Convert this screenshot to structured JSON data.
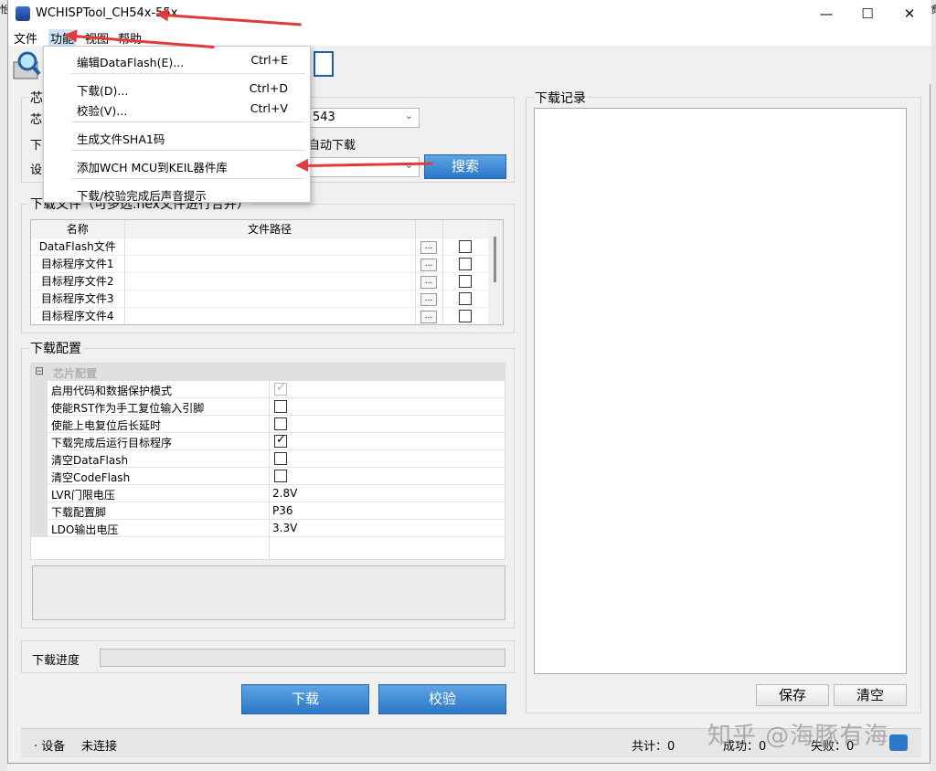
{
  "window": {
    "title": "WCHISPTool_CH54x-55x",
    "minimize": "—",
    "maximize": "☐",
    "close": "✕"
  },
  "menubar": {
    "file": "文件",
    "function": "功能",
    "view": "视图",
    "help": "帮助"
  },
  "left_clip": {
    "top": "怡",
    "chip_title": "芯",
    "chip_label": "芯",
    "download_label": "下",
    "device_label": "设"
  },
  "chip": {
    "model_value": "543",
    "auto_download": "自动下载",
    "search_button": "搜索"
  },
  "files": {
    "title": "下载文件（可多选.hex文件进行合并）",
    "columns": [
      "名称",
      "文件路径"
    ],
    "rows": [
      {
        "name": "DataFlash文件",
        "path": "",
        "browse": "...",
        "checked": false
      },
      {
        "name": "目标程序文件1",
        "path": "",
        "browse": "...",
        "checked": false
      },
      {
        "name": "目标程序文件2",
        "path": "",
        "browse": "...",
        "checked": false
      },
      {
        "name": "目标程序文件3",
        "path": "",
        "browse": "...",
        "checked": false
      },
      {
        "name": "目标程序文件4",
        "path": "",
        "browse": "...",
        "checked": false
      }
    ]
  },
  "config": {
    "title": "下载配置",
    "section": "芯片配置",
    "expander": "⊟",
    "rows": [
      {
        "label": "启用代码和数据保护模式",
        "type": "check",
        "checked": true,
        "disabled": true
      },
      {
        "label": "使能RST作为手工复位输入引脚",
        "type": "check",
        "checked": false,
        "disabled": false
      },
      {
        "label": "使能上电复位后长延时",
        "type": "check",
        "checked": false,
        "disabled": false
      },
      {
        "label": "下载完成后运行目标程序",
        "type": "check",
        "checked": true,
        "disabled": false
      },
      {
        "label": "清空DataFlash",
        "type": "check",
        "checked": false,
        "disabled": false
      },
      {
        "label": "清空CodeFlash",
        "type": "check",
        "checked": false,
        "disabled": false
      },
      {
        "label": "LVR门限电压",
        "type": "value",
        "value": "2.8V"
      },
      {
        "label": "下载配置脚",
        "type": "value",
        "value": "P36"
      },
      {
        "label": "LDO输出电压",
        "type": "value",
        "value": "3.3V"
      }
    ]
  },
  "progress": {
    "label": "下载进度",
    "value": 0
  },
  "actions": {
    "download": "下载",
    "verify": "校验"
  },
  "log": {
    "title": "下载记录",
    "save": "保存",
    "clear": "清空"
  },
  "status": {
    "device_prefix": "· 设备",
    "device_state": "未连接",
    "total": "共计：0",
    "success": "成功：0",
    "fail": "失败：0",
    "right_clip": "愤"
  },
  "watermark": "知乎 @海豚有海",
  "dropdown_menu": {
    "items": [
      {
        "label": "编辑DataFlash(E)...",
        "shortcut": "Ctrl+E"
      },
      {
        "label": "下载(D)...",
        "shortcut": "Ctrl+D"
      },
      {
        "label": "校验(V)...",
        "shortcut": "Ctrl+V"
      },
      {
        "label": "生成文件SHA1码",
        "shortcut": ""
      },
      {
        "label": "添加WCH MCU到KEIL器件库",
        "shortcut": ""
      },
      {
        "label": "下载/校验完成后声音提示",
        "shortcut": ""
      }
    ]
  },
  "colors": {
    "arrow": "#e23a3a",
    "button_blue": "#2b78c9"
  }
}
